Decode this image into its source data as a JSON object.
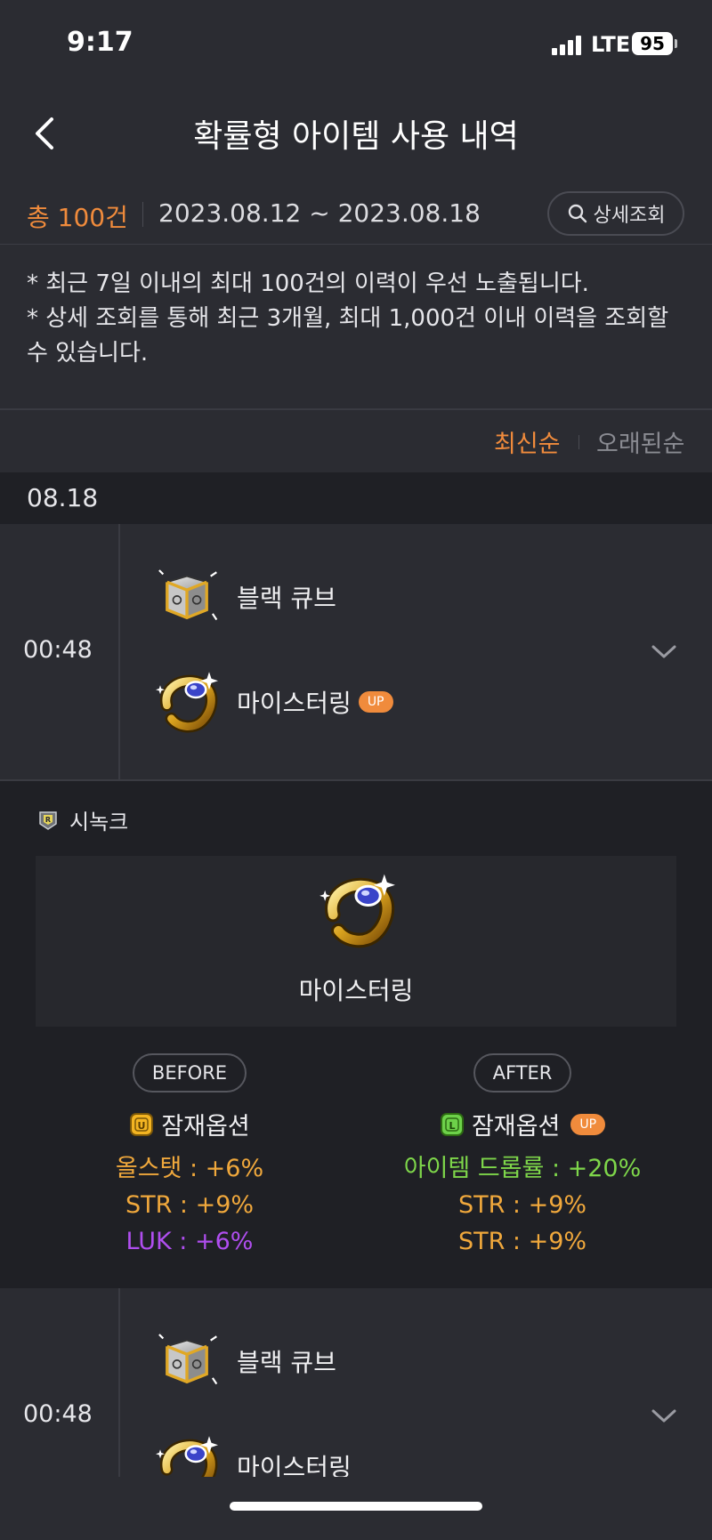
{
  "status_bar": {
    "time": "9:17",
    "network": "LTE",
    "battery": "95"
  },
  "header": {
    "title": "확률형 아이템 사용 내역",
    "back_icon": "chevron-left-icon"
  },
  "summary": {
    "total": "총 100건",
    "date_range": "2023.08.12 ~ 2023.08.18",
    "detail_search_label": "상세조회"
  },
  "notice": {
    "line1": "* 최근 7일 이내의 최대 100건의 이력이 우선 노출됩니다.",
    "line2": "* 상세 조회를 통해 최근 3개월, 최대 1,000건 이내 이력을 조회할 수 있습니다."
  },
  "sort": {
    "newest": "최신순",
    "oldest": "오래된순"
  },
  "date_group": "08.18",
  "entries": [
    {
      "time": "00:48",
      "cube_name": "블랙 큐브",
      "item_name": "마이스터링",
      "badge": "UP"
    },
    {
      "time": "00:48",
      "cube_name": "블랙 큐브",
      "item_name": "마이스터링"
    }
  ],
  "detail": {
    "server": "시녹크",
    "item_name": "마이스터링",
    "before": {
      "label": "BEFORE",
      "option_title": "잠재옵션",
      "grade_icon": "U",
      "options": [
        {
          "text": "올스탯 : +6%",
          "color": "#f0a83c"
        },
        {
          "text": "STR : +9%",
          "color": "#f0a83c"
        },
        {
          "text": "LUK : +6%",
          "color": "#b04ef0"
        }
      ]
    },
    "after": {
      "label": "AFTER",
      "option_title": "잠재옵션",
      "grade_icon": "L",
      "badge": "UP",
      "options": [
        {
          "text": "아이템 드롭률 : +20%",
          "color": "#7ed64a"
        },
        {
          "text": "STR : +9%",
          "color": "#f0a83c"
        },
        {
          "text": "STR : +9%",
          "color": "#f0a83c"
        }
      ]
    }
  },
  "colors": {
    "accent": "#f08b3c",
    "background": "#2b2c32",
    "section_dark": "#1f2025"
  }
}
